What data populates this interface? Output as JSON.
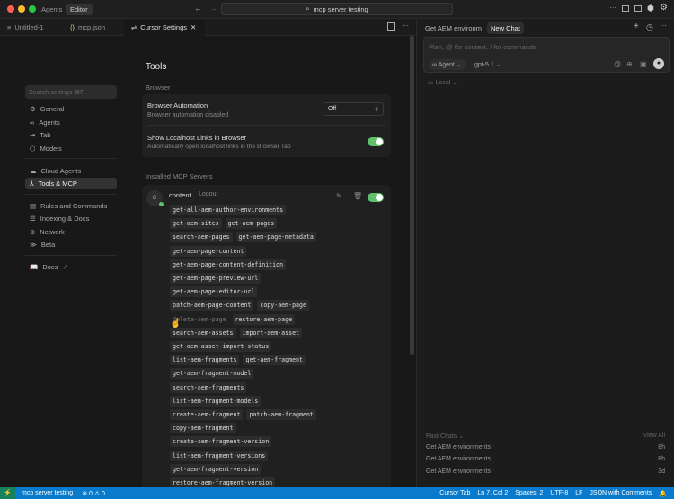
{
  "titlebar": {
    "agents": "Agents",
    "editor": "Editor",
    "search": "mcp server testing"
  },
  "tabs": [
    {
      "label": "Untitled-1"
    },
    {
      "label": "mcp.json"
    },
    {
      "label": "Cursor Settings"
    }
  ],
  "settings": {
    "search_placeholder": "Search settings ⌘F",
    "nav": [
      "General",
      "Agents",
      "Tab",
      "Models",
      "Cloud Agents",
      "Tools & MCP",
      "Rules and Commands",
      "Indexing & Docs",
      "Network",
      "Beta",
      "Docs"
    ],
    "title": "Tools",
    "browser_section": "Browser",
    "browser_automation": {
      "title": "Browser Automation",
      "desc": "Browser automation disabled",
      "value": "Off"
    },
    "localhost": {
      "title": "Show Localhost Links in Browser",
      "desc": "Automatically open localhost links in the Browser Tab",
      "enabled": true
    },
    "mcp_section": "Installed MCP Servers",
    "server": {
      "avatar": "C",
      "name": "content",
      "logout": "Logout",
      "enabled": true,
      "tool_rows": [
        [
          "get-all-aem-author-environments"
        ],
        [
          "get-aem-sites",
          "get-aem-pages"
        ],
        [
          "search-aem-pages",
          "get-aem-page-metadata"
        ],
        [
          "get-aem-page-content"
        ],
        [
          "get-aem-page-content-definition"
        ],
        [
          "get-aem-page-preview-url"
        ],
        [
          "get-aem-page-editor-url"
        ],
        [
          "patch-aem-page-content",
          "copy-aem-page"
        ],
        [
          "delete-aem-page",
          "restore-aem-page"
        ],
        [
          "search-aem-assets",
          "import-aem-asset"
        ],
        [
          "get-aem-asset-import-status"
        ],
        [
          "list-aem-fragments",
          "get-aem-fragment"
        ],
        [
          "get-aem-fragment-model"
        ],
        [
          "search-aem-fragments"
        ],
        [
          "list-aem-fragment-models"
        ],
        [
          "create-aem-fragment",
          "patch-aem-fragment"
        ],
        [
          "copy-aem-fragment"
        ],
        [
          "create-aem-fragment-version"
        ],
        [
          "list-aem-fragment-versions"
        ],
        [
          "get-aem-fragment-version"
        ],
        [
          "restore-aem-fragment-version"
        ]
      ]
    }
  },
  "chat": {
    "tab1": "Get AEM environm",
    "tab2": "New Chat",
    "placeholder": "Plan, @ for context, / for commands",
    "mode": "Agent",
    "model": "gpt-5.1",
    "location": "Local",
    "past_label": "Past Chats",
    "view_all": "View All",
    "past": [
      {
        "title": "Get AEM environments",
        "age": "8h"
      },
      {
        "title": "Get AEM environments",
        "age": "8h"
      },
      {
        "title": "Get AEM environments",
        "age": "3d"
      }
    ]
  },
  "status": {
    "branch": "mcp server testing",
    "problems": "⊗ 0 ⚠ 0",
    "cursor_tab": "Cursor Tab",
    "pos": "Ln 7, Col 2",
    "spaces": "Spaces: 2",
    "enc": "UTF-8",
    "eol": "LF",
    "lang": "JSON with Comments"
  }
}
